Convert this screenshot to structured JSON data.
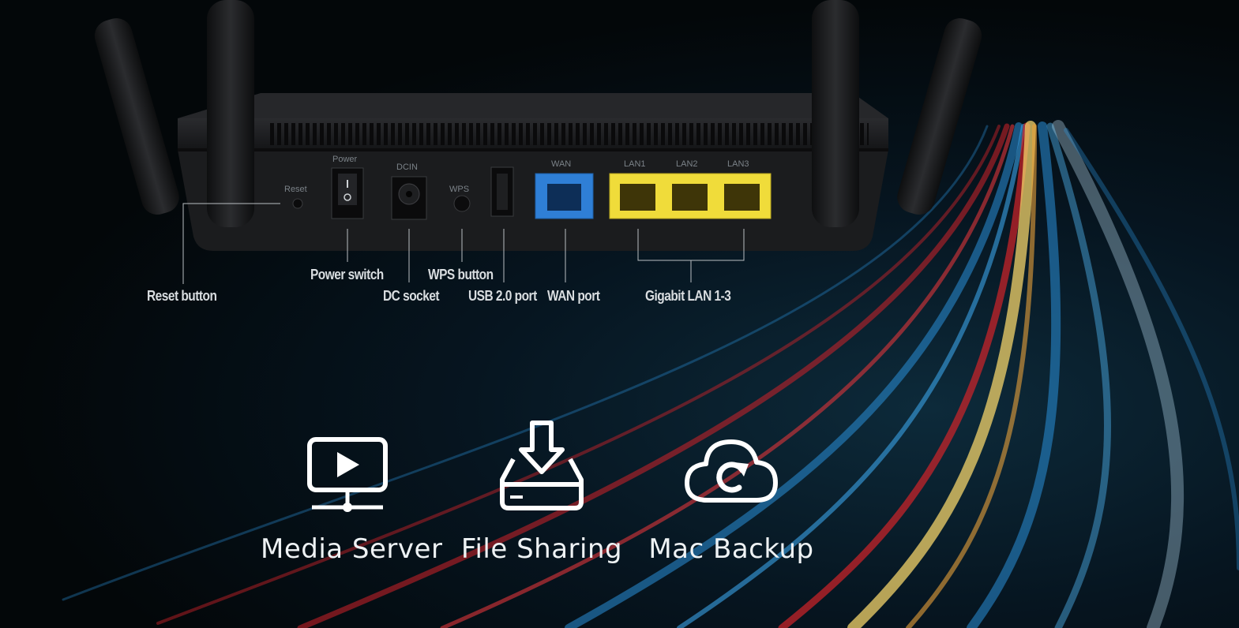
{
  "router": {
    "port_labels": {
      "power": "Power",
      "reset": "Reset",
      "dcin": "DCIN",
      "wps": "WPS",
      "wan": "WAN",
      "lan1": "LAN1",
      "lan2": "LAN2",
      "lan3": "LAN3"
    }
  },
  "callouts": {
    "reset_button": "Reset button",
    "power_switch": "Power switch",
    "dc_socket": "DC socket",
    "wps_button": "WPS button",
    "usb_port": "USB 2.0 port",
    "wan_port": "WAN port",
    "gigabit_lan": "Gigabit LAN 1-3"
  },
  "features": [
    {
      "label": "Media Server",
      "icon": "media-server-icon"
    },
    {
      "label": "File Sharing",
      "icon": "file-sharing-icon"
    },
    {
      "label": "Mac Backup",
      "icon": "mac-backup-icon"
    }
  ],
  "colors": {
    "wan_port": "#2f7fd6",
    "lan_port": "#f0dc3a",
    "router_body": "#1c1d1f",
    "streak_red": "#d2232a",
    "streak_blue": "#2a8fd8",
    "streak_yellow": "#f3d36a"
  }
}
